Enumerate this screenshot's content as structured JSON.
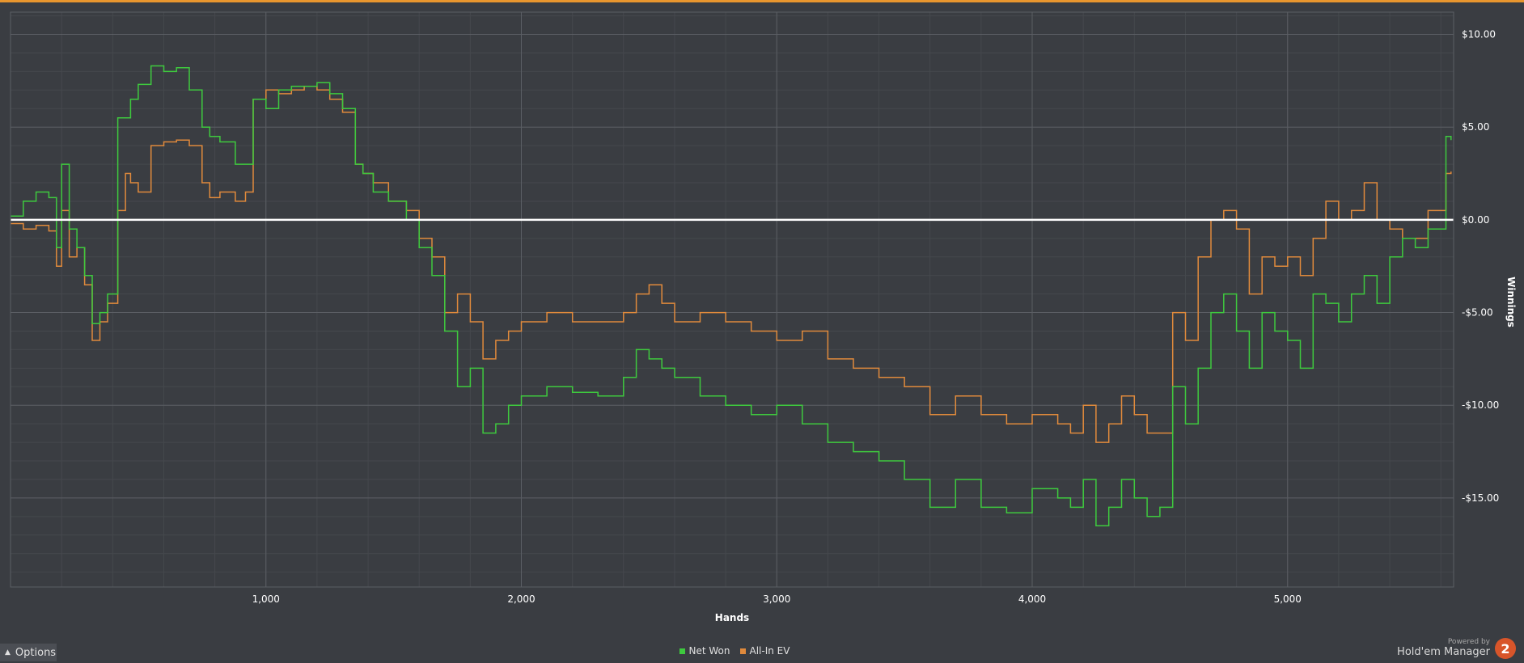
{
  "colors": {
    "accent": "#e8962e",
    "net_won": "#3ec93e",
    "all_in_ev": "#e08a3c",
    "background": "#3a3d42",
    "zero_line": "#ffffff",
    "grid_major": "#5b5e64",
    "grid_minor": "#45484d"
  },
  "footer": {
    "options_label": "Options",
    "options_icon": "chevron-up-icon",
    "brand_small": "Powered by",
    "brand_big": "Hold'em Manager",
    "brand_logo": "2"
  },
  "chart_data": {
    "type": "line",
    "title": "",
    "xlabel": "Hands",
    "ylabel": "Winnings",
    "xlim": [
      0,
      5650
    ],
    "ylim": [
      -19.8,
      11.2
    ],
    "x_ticks": [
      1000,
      2000,
      3000,
      4000,
      5000
    ],
    "x_tick_labels": [
      "1,000",
      "2,000",
      "3,000",
      "4,000",
      "5,000"
    ],
    "y_ticks": [
      10,
      5,
      0,
      -5,
      -10,
      -15
    ],
    "y_tick_labels": [
      "$10.00",
      "$5.00",
      "$0.00",
      "-$5.00",
      "-$10.00",
      "-$15.00"
    ],
    "grid": true,
    "legend_position": "bottom-center",
    "series": [
      {
        "name": "Net Won",
        "x": [
          0,
          50,
          100,
          150,
          180,
          200,
          230,
          260,
          290,
          320,
          350,
          380,
          420,
          450,
          470,
          500,
          550,
          600,
          650,
          700,
          750,
          780,
          820,
          880,
          920,
          950,
          1000,
          1050,
          1100,
          1150,
          1200,
          1250,
          1300,
          1350,
          1380,
          1420,
          1480,
          1550,
          1600,
          1650,
          1700,
          1750,
          1800,
          1850,
          1900,
          1950,
          2000,
          2100,
          2200,
          2300,
          2400,
          2450,
          2500,
          2550,
          2600,
          2700,
          2800,
          2900,
          3000,
          3100,
          3200,
          3300,
          3400,
          3500,
          3600,
          3700,
          3800,
          3900,
          4000,
          4100,
          4150,
          4200,
          4250,
          4300,
          4350,
          4400,
          4450,
          4500,
          4550,
          4600,
          4650,
          4700,
          4750,
          4800,
          4850,
          4900,
          4950,
          5000,
          5050,
          5100,
          5150,
          5200,
          5250,
          5300,
          5350,
          5400,
          5450,
          5500,
          5550,
          5600,
          5620,
          5640
        ],
        "y": [
          0.2,
          1.0,
          1.5,
          1.2,
          -1.5,
          3.0,
          -0.5,
          -1.5,
          -3.0,
          -5.6,
          -5.0,
          -4.0,
          5.5,
          5.5,
          6.5,
          7.3,
          8.3,
          8.0,
          8.2,
          7.0,
          5.0,
          4.5,
          4.2,
          3.0,
          3.0,
          6.5,
          6.0,
          7.0,
          7.2,
          7.2,
          7.4,
          6.8,
          6.0,
          3.0,
          2.5,
          1.5,
          1.0,
          0.0,
          -1.5,
          -3.0,
          -6.0,
          -9.0,
          -8.0,
          -11.5,
          -11.0,
          -10.0,
          -9.5,
          -9.0,
          -9.3,
          -9.5,
          -8.5,
          -7.0,
          -7.5,
          -8.0,
          -8.5,
          -9.5,
          -10.0,
          -10.5,
          -10.0,
          -11.0,
          -12.0,
          -12.5,
          -13.0,
          -14.0,
          -15.5,
          -14.0,
          -15.5,
          -15.8,
          -14.5,
          -15.0,
          -15.5,
          -14.0,
          -16.5,
          -15.5,
          -14.0,
          -15.0,
          -16.0,
          -15.5,
          -9.0,
          -11.0,
          -8.0,
          -5.0,
          -4.0,
          -6.0,
          -8.0,
          -5.0,
          -6.0,
          -6.5,
          -8.0,
          -4.0,
          -4.5,
          -5.5,
          -4.0,
          -3.0,
          -4.5,
          -2.0,
          -1.0,
          -1.5,
          -0.5,
          -0.5,
          4.5,
          4.3
        ]
      },
      {
        "name": "All-In EV",
        "x": [
          0,
          50,
          100,
          150,
          180,
          200,
          230,
          260,
          290,
          320,
          350,
          380,
          420,
          450,
          470,
          500,
          550,
          600,
          650,
          700,
          750,
          780,
          820,
          880,
          920,
          950,
          1000,
          1050,
          1100,
          1150,
          1200,
          1250,
          1300,
          1350,
          1380,
          1420,
          1480,
          1550,
          1600,
          1650,
          1700,
          1750,
          1800,
          1850,
          1900,
          1950,
          2000,
          2100,
          2200,
          2300,
          2400,
          2450,
          2500,
          2550,
          2600,
          2700,
          2800,
          2900,
          3000,
          3100,
          3200,
          3300,
          3400,
          3500,
          3600,
          3700,
          3800,
          3900,
          4000,
          4100,
          4150,
          4200,
          4250,
          4300,
          4350,
          4400,
          4450,
          4500,
          4550,
          4600,
          4650,
          4700,
          4750,
          4800,
          4850,
          4900,
          4950,
          5000,
          5050,
          5100,
          5150,
          5200,
          5250,
          5300,
          5350,
          5400,
          5450,
          5500,
          5550,
          5600,
          5620,
          5640
        ],
        "y": [
          -0.2,
          -0.5,
          -0.3,
          -0.6,
          -2.5,
          0.5,
          -2.0,
          -1.5,
          -3.5,
          -6.5,
          -5.5,
          -4.5,
          0.5,
          2.5,
          2.0,
          1.5,
          4.0,
          4.2,
          4.3,
          4.0,
          2.0,
          1.2,
          1.5,
          1.0,
          1.5,
          6.5,
          7.0,
          6.8,
          7.0,
          7.2,
          7.0,
          6.5,
          5.8,
          3.0,
          2.5,
          2.0,
          1.0,
          0.5,
          -1.0,
          -2.0,
          -5.0,
          -4.0,
          -5.5,
          -7.5,
          -6.5,
          -6.0,
          -5.5,
          -5.0,
          -5.5,
          -5.5,
          -5.0,
          -4.0,
          -3.5,
          -4.5,
          -5.5,
          -5.0,
          -5.5,
          -6.0,
          -6.5,
          -6.0,
          -7.5,
          -8.0,
          -8.5,
          -9.0,
          -10.5,
          -9.5,
          -10.5,
          -11.0,
          -10.5,
          -11.0,
          -11.5,
          -10.0,
          -12.0,
          -11.0,
          -9.5,
          -10.5,
          -11.5,
          -11.5,
          -5.0,
          -6.5,
          -2.0,
          0.0,
          0.5,
          -0.5,
          -4.0,
          -2.0,
          -2.5,
          -2.0,
          -3.0,
          -1.0,
          1.0,
          0.0,
          0.5,
          2.0,
          0.0,
          -0.5,
          -1.0,
          -1.0,
          0.5,
          0.5,
          2.5,
          2.6
        ]
      }
    ]
  }
}
